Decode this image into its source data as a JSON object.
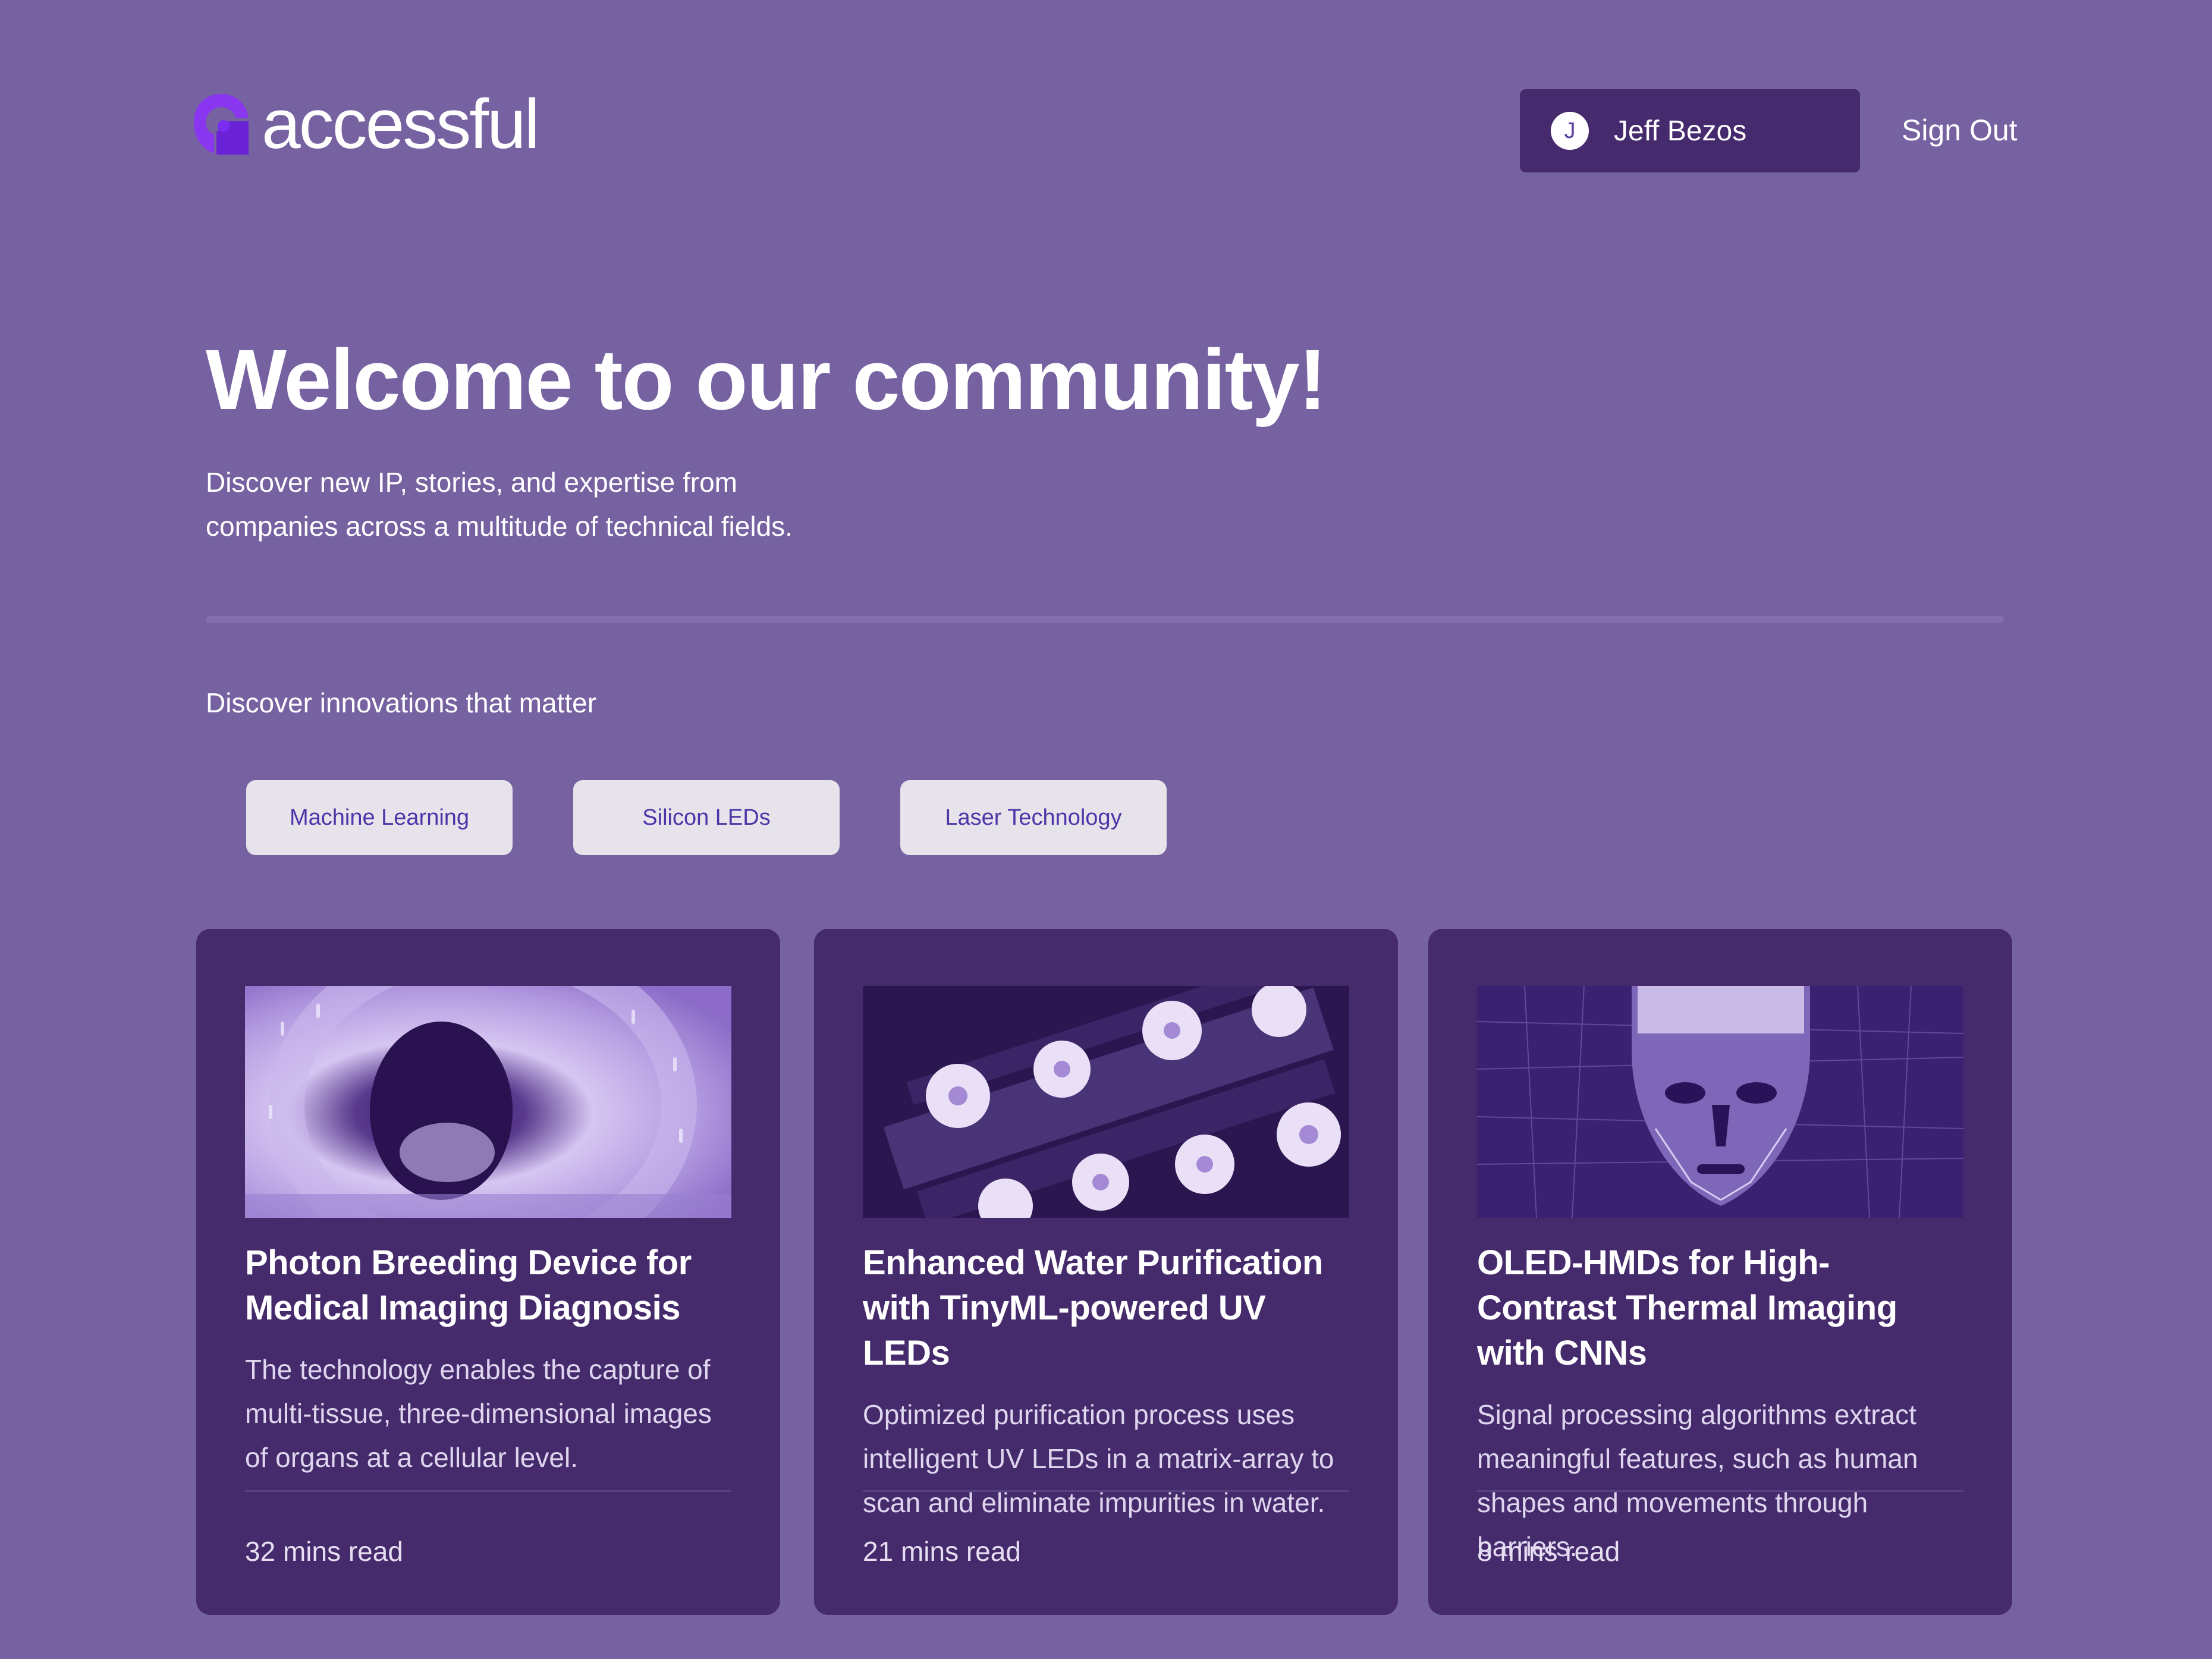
{
  "header": {
    "logo_text": "accessful",
    "user": {
      "initial": "J",
      "name": "Jeff Bezos"
    },
    "sign_out_label": "Sign Out"
  },
  "hero": {
    "title": "Welcome to our community!",
    "subtitle": "Discover new IP, stories, and expertise from companies across a multitude of technical fields."
  },
  "topics": {
    "label": "Discover innovations that matter",
    "chips": [
      {
        "label": "Machine Learning"
      },
      {
        "label": "Silicon LEDs"
      },
      {
        "label": "Laser Technology"
      }
    ]
  },
  "cards": [
    {
      "title": "Photon Breeding Device for Medical Imaging Diagnosis",
      "description": "The technology enables the capture of multi-tissue, three-dimensional images of organs at a cellular level.",
      "read_time": "32 mins read"
    },
    {
      "title": "Enhanced Water Purification with TinyML-powered UV LEDs",
      "description": "Optimized purification process uses intelligent UV LEDs in a matrix-array to scan and eliminate impurities in water.",
      "read_time": "21 mins read"
    },
    {
      "title": "OLED-HMDs for High-Contrast Thermal Imaging with CNNs",
      "description": "Signal processing algorithms extract meaningful features, such as human shapes and movements through barriers.",
      "read_time": "8 mins read"
    }
  ],
  "colors": {
    "page_background": "#7662a1",
    "card_background": "#452a6c",
    "user_pill_background": "#452a6e",
    "chip_background": "#e6e4ea",
    "chip_text": "#4b35a8",
    "logo_accent": "#7a2cf0"
  }
}
